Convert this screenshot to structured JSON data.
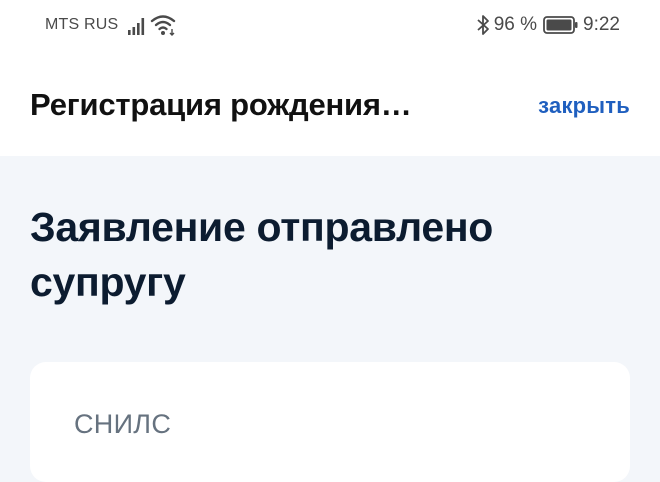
{
  "status_bar": {
    "carrier": "MTS RUS",
    "battery_percent": "96 %",
    "time": "9:22"
  },
  "header": {
    "title": "Регистрация рождения…",
    "close_label": "закрыть"
  },
  "main": {
    "title": "Заявление отправлено супругу",
    "card": {
      "label": "СНИЛС"
    }
  },
  "colors": {
    "accent": "#1f5fbf",
    "background": "#f3f6fa",
    "title": "#0c1c30"
  }
}
